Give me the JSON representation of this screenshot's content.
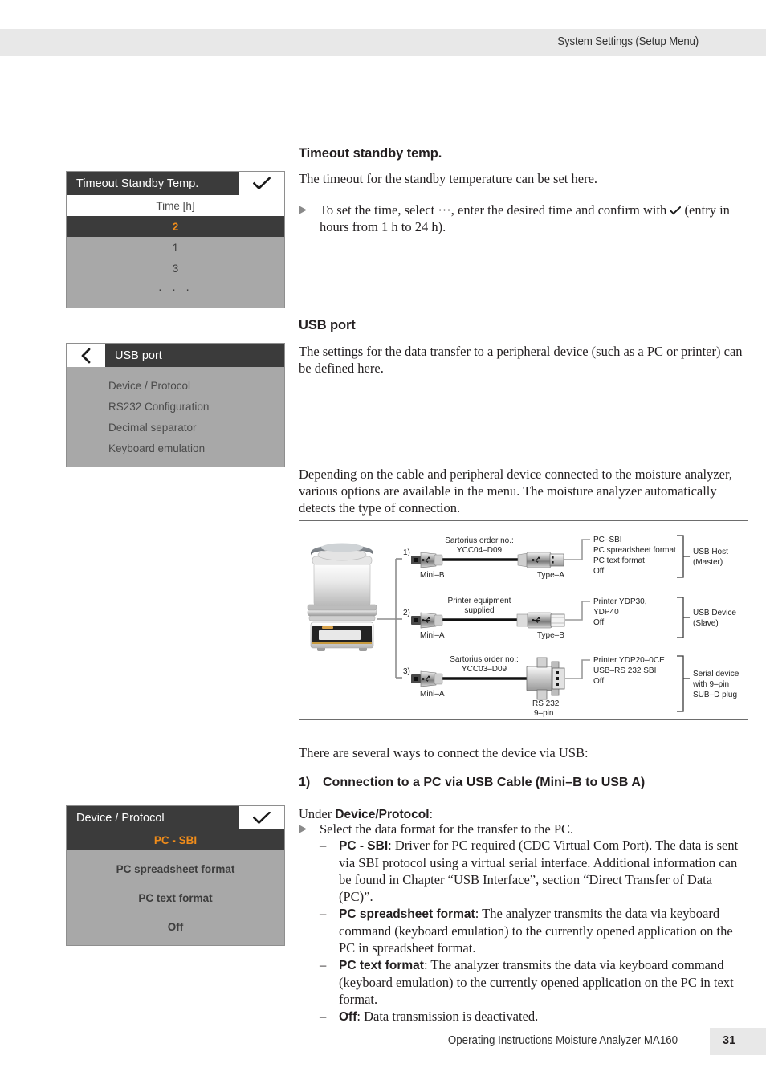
{
  "header": {
    "title": "System Settings (Setup Menu)"
  },
  "footer": {
    "title": "Operating Instructions Moisture Analyzer MA160",
    "page_number": "31"
  },
  "screens": {
    "timeout_standby": {
      "title": "Timeout Standby Temp.",
      "confirm_icon": "check-icon",
      "column_header": "Time [h]",
      "rows": [
        {
          "label": "2",
          "selected": true
        },
        {
          "label": "1",
          "selected": false
        },
        {
          "label": "3",
          "selected": false
        },
        {
          "label": "· · ·",
          "selected": false
        }
      ]
    },
    "usb_port": {
      "back_icon": "chevron-left-icon",
      "title": "USB port",
      "items": [
        "Device / Protocol",
        "RS232 Configuration",
        "Decimal separator",
        "Keyboard emulation"
      ]
    },
    "device_protocol": {
      "title": "Device / Protocol",
      "confirm_icon": "check-icon",
      "rows": [
        {
          "label": "PC - SBI",
          "selected": true
        },
        {
          "label": "PC spreadsheet format",
          "selected": false
        },
        {
          "label": "PC text format",
          "selected": false
        },
        {
          "label": "Off",
          "selected": false
        }
      ]
    }
  },
  "content": {
    "timeout": {
      "heading": "Timeout standby temp.",
      "description": "The timeout for the standby temperature can be set here.",
      "bullet_part1": "To set the time, select ",
      "bullet_dots": "···",
      "bullet_part2": ", enter the desired time and confirm with ",
      "bullet_part3": " (entry in hours from 1 h to 24 h)."
    },
    "usb": {
      "heading": "USB port",
      "description": "The settings for the data transfer to a peripheral device (such as a PC or printer) can be defined here.",
      "depends": "Depending on the cable and peripheral device connected to the moisture analyzer, various options are available in the menu. The moisture analyzer automatically detects the type of connection.",
      "ways": "There are several ways to connect the device via USB:",
      "connection_number": "1)",
      "connection_title": "Connection to a PC via USB Cable (Mini–B to USB A)",
      "under_prefix": "Under ",
      "under_bold": "Device/Protocol",
      "under_suffix": ":",
      "select_bullet": "Select the data format for the transfer to the PC.",
      "items": [
        {
          "dash": "–",
          "bold": "PC - SBI",
          "text": ": Driver for PC required (CDC Virtual Com Port). The data is sent via SBI protocol using a virtual serial interface. Additional information can be found in Chapter “USB Interface”, section “Direct Transfer of Data (PC)”."
        },
        {
          "dash": "–",
          "bold": "PC spreadsheet format",
          "text": ": The analyzer transmits the data via keyboard command (keyboard emulation) to the currently opened application on the PC in spreadsheet format."
        },
        {
          "dash": "–",
          "bold": "PC text format",
          "text": ": The analyzer transmits the data via keyboard command (keyboard emulation) to the currently opened application on the PC in text format."
        },
        {
          "dash": "–",
          "bold": "Off",
          "text": ": Data transmission is deactivated."
        }
      ]
    }
  },
  "diagram": {
    "device_label": "moisture-analyzer",
    "rows": [
      {
        "number": "1)",
        "cable_label_line1": "Sartorius order no.:",
        "cable_label_line2": "YCC04–D09",
        "left_connector": "Mini–B",
        "right_connector": "Type–A",
        "options": [
          "PC–SBI",
          "PC spreadsheet format",
          "PC text format",
          "Off"
        ],
        "group_line1": "USB Host",
        "group_line2": "(Master)"
      },
      {
        "number": "2)",
        "cable_label_line1": "Printer equipment",
        "cable_label_line2": "supplied",
        "left_connector": "Mini–A",
        "right_connector": "Type–B",
        "options": [
          "Printer YDP30,",
          "YDP40",
          "Off"
        ],
        "group_line1": "USB Device",
        "group_line2": "(Slave)"
      },
      {
        "number": "3)",
        "cable_label_line1": "Sartorius order no.:",
        "cable_label_line2": "YCC03–D09",
        "left_connector": "Mini–A",
        "right_connector": "RS 232",
        "right_connector2": "9–pin",
        "options": [
          "Printer YDP20–0CE",
          "USB–RS 232 SBI",
          "Off"
        ],
        "group_line1": "Serial device",
        "group_line2": "with 9–pin",
        "group_line3": "SUB–D plug"
      }
    ]
  },
  "colors": {
    "accent_orange": "#f08c1a",
    "screen_dark": "#3b3b3b",
    "screen_gray": "#a8a8a8",
    "header_gray": "#e8e8e8"
  }
}
